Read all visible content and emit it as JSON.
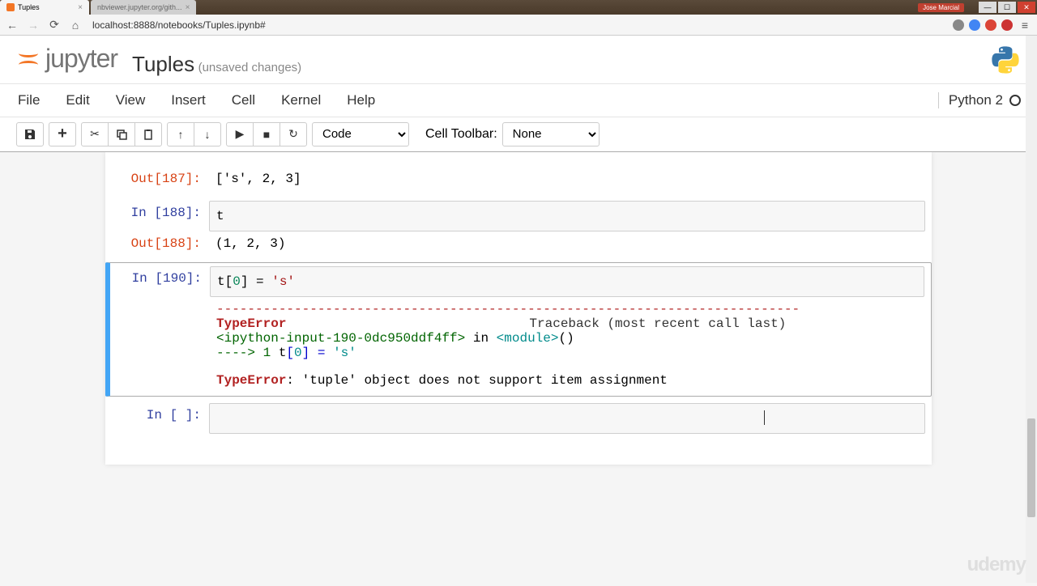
{
  "browser": {
    "tab1_title": "Tuples",
    "tab2_title": "nbviewer.jupyter.org/gith...",
    "user_badge": "Jose Marcial",
    "url": "localhost:8888/notebooks/Tuples.ipynb#"
  },
  "header": {
    "logo_text": "jupyter",
    "notebook_name": "Tuples",
    "notebook_status": "(unsaved changes)"
  },
  "menu": {
    "file": "File",
    "edit": "Edit",
    "view": "View",
    "insert": "Insert",
    "cell": "Cell",
    "kernel": "Kernel",
    "help": "Help",
    "kernel_name": "Python 2"
  },
  "toolbar": {
    "cell_type": "Code",
    "cell_toolbar_label": "Cell Toolbar:",
    "cell_toolbar_value": "None"
  },
  "cells": {
    "out187_prompt": "Out[187]:",
    "out187_value": "['s', 2, 3]",
    "in188_prompt": "In [188]:",
    "in188_code": "t",
    "out188_prompt": "Out[188]:",
    "out188_value": "(1, 2, 3)",
    "in190_prompt": "In [190]:",
    "in190_code_pre": "t[",
    "in190_code_idx": "0",
    "in190_code_mid": "] = ",
    "in190_code_str": "'s'",
    "err_dashes": "---------------------------------------------------------------------------",
    "err_type": "TypeError",
    "err_traceback": "Traceback (most recent call last)",
    "err_file": "<ipython-input-190-0dc950ddf4ff>",
    "err_in": " in ",
    "err_module": "<module>",
    "err_parens": "()",
    "err_arrow": "----> 1",
    "err_line_t": " t",
    "err_line_br1": "[",
    "err_line_0": "0",
    "err_line_br2": "]",
    "err_line_eq": " = ",
    "err_line_s": "'s'",
    "err_final_name": "TypeError",
    "err_final_colon": ": ",
    "err_final_msg": "'tuple' object does not support item assignment",
    "in_empty_prompt": "In [ ]:"
  }
}
